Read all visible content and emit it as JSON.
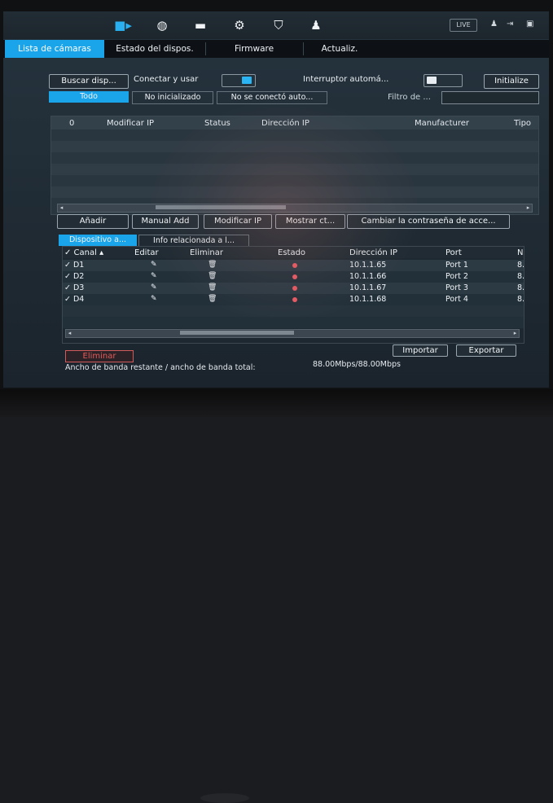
{
  "topbar": {
    "icons": [
      {
        "name": "camera-icon",
        "glyph": "■▶",
        "active": true
      },
      {
        "name": "network-icon",
        "glyph": "🌐"
      },
      {
        "name": "storage-icon",
        "glyph": "▬"
      },
      {
        "name": "system-settings-icon",
        "glyph": "⚙⚙"
      },
      {
        "name": "shield-icon",
        "glyph": "⛉"
      },
      {
        "name": "account-icon",
        "glyph": "👤"
      }
    ],
    "live_label": "LIVE",
    "right_icons": [
      "user-icon",
      "logout-icon",
      "window-icon"
    ]
  },
  "tabs": [
    "Lista de cámaras",
    "Estado del dispos.",
    "Firmware",
    "Actualiz."
  ],
  "toolbar": {
    "search_button": "Buscar disp...",
    "connect_label": "Conectar y usar",
    "auto_switch_label": "Interruptor automá...",
    "initialize_button": "Initialize"
  },
  "filter": {
    "tabs": [
      "Todo",
      "No inicializado",
      "No se conectó auto..."
    ],
    "filter_label": "Filtro de ...",
    "filter_value": ""
  },
  "found_table": {
    "columns": [
      "0",
      "Modificar IP",
      "Status",
      "Dirección IP",
      "Manufacturer",
      "Tipo"
    ]
  },
  "actions": {
    "add": "Añadir",
    "manual_add": "Manual Add",
    "modify_ip": "Modificar IP",
    "show": "Mostrar ct...",
    "change_password": "Cambiar la contraseña de acce..."
  },
  "added_tabs": [
    "Dispositivo a...",
    "Info relacionada a l..."
  ],
  "added_table": {
    "columns": [
      "✓ Canal ▴",
      "Editar",
      "Eliminar",
      "Estado",
      "Dirección IP",
      "Port",
      "N"
    ],
    "rows": [
      {
        "channel": "✓ D1",
        "ip": "10.1.1.65",
        "port": "Port 1",
        "n": "8."
      },
      {
        "channel": "✓ D2",
        "ip": "10.1.1.66",
        "port": "Port 2",
        "n": "8."
      },
      {
        "channel": "✓ D3",
        "ip": "10.1.1.67",
        "port": "Port 3",
        "n": "8."
      },
      {
        "channel": "✓ D4",
        "ip": "10.1.1.68",
        "port": "Port 4",
        "n": "8."
      }
    ],
    "status_color": "#f05a64"
  },
  "footer": {
    "delete_button": "Eliminar",
    "import_button": "Importar",
    "export_button": "Exportar",
    "bandwidth_label": "Ancho de banda restante / ancho de banda total:",
    "bandwidth_value": "88.00Mbps/88.00Mbps"
  },
  "colors": {
    "accent": "#1aa4ea",
    "status": "#f05a64"
  }
}
